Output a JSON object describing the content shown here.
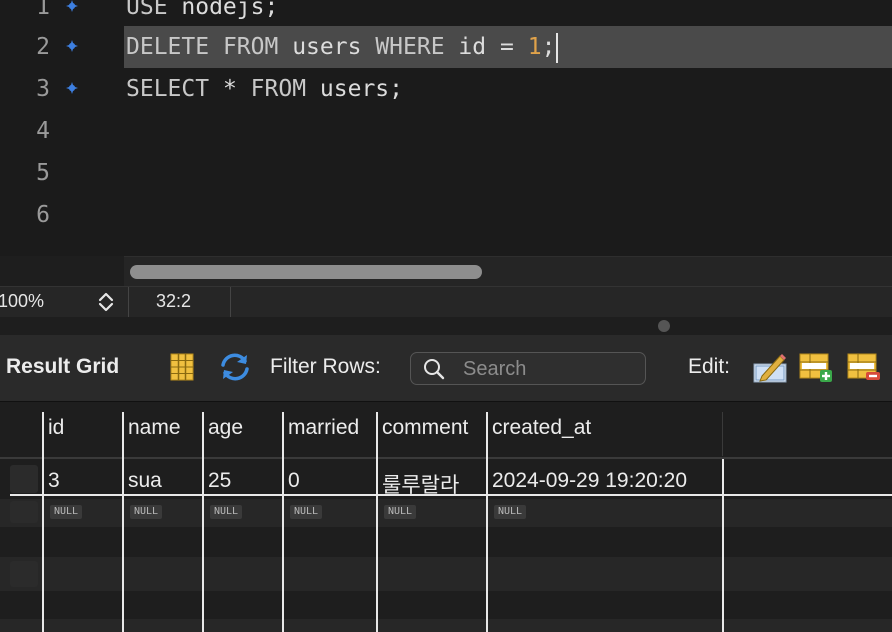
{
  "editor": {
    "lines": [
      {
        "num": "1",
        "code_kw1": "USE",
        "code_rest": " nodejs;"
      },
      {
        "num": "2",
        "kw_delete": "DELETE",
        "kw_from": "FROM",
        "ident": "users",
        "kw_where": "WHERE",
        "col": "id",
        "op": "=",
        "value": "1",
        "end": ";"
      },
      {
        "num": "3",
        "kw_select": "SELECT",
        "star": "*",
        "kw_from": "FROM",
        "ident": "users",
        "end": ";"
      },
      {
        "num": "4"
      },
      {
        "num": "5"
      },
      {
        "num": "6"
      }
    ]
  },
  "status": {
    "zoom": "100%",
    "cursor": "32:2"
  },
  "toolbar": {
    "title": "Result Grid",
    "filter_label": "Filter Rows:",
    "search_placeholder": "Search",
    "edit_label": "Edit:"
  },
  "grid": {
    "columns": [
      "id",
      "name",
      "age",
      "married",
      "comment",
      "created_at"
    ],
    "rows": [
      [
        "3",
        "sua",
        "25",
        "0",
        "룰루랄라",
        "2024-09-29 19:20:20"
      ]
    ],
    "null_label": "NULL"
  },
  "colors": {
    "accent": "#4a90e2",
    "number": "#e0a24a",
    "marker": "#3d7fe0"
  }
}
